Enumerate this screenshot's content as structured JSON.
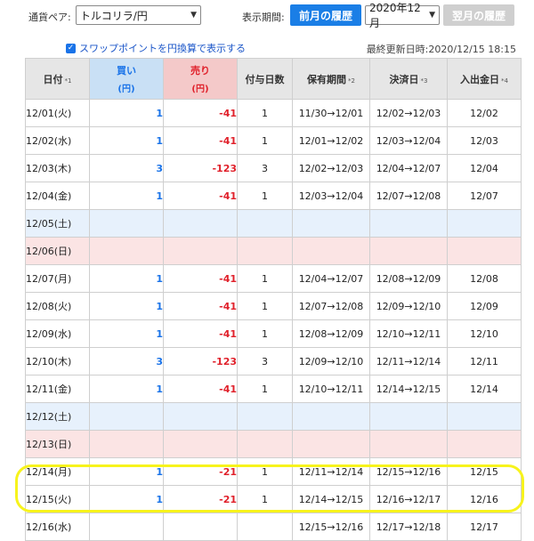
{
  "header": {
    "pair_label": "通貨ペア:",
    "pair_value": "トルコリラ/円",
    "period_label": "表示期間:",
    "prev_button": "前月の履歴",
    "month_value": "2020年12月",
    "next_button": "翌月の履歴"
  },
  "options": {
    "swap_yen_label": "スワップポイントを円換算で表示する",
    "swap_yen_checked": true
  },
  "updated": "最終更新日時:2020/12/15 18:15",
  "table": {
    "headers": {
      "date": "日付",
      "date_note": "*1",
      "buy": "買い",
      "buy_unit": "(円)",
      "sell": "売り",
      "sell_unit": "(円)",
      "days": "付与日数",
      "period": "保有期間",
      "period_note": "*2",
      "settle": "決済日",
      "settle_note": "*3",
      "cash": "入出金日",
      "cash_note": "*4"
    },
    "rows": [
      {
        "date": "12/01(火)",
        "buy": "1",
        "sell": "-41",
        "days": "1",
        "period": "11/30→12/01",
        "settle": "12/02→12/03",
        "cash": "12/02",
        "type": "weekday"
      },
      {
        "date": "12/02(水)",
        "buy": "1",
        "sell": "-41",
        "days": "1",
        "period": "12/01→12/02",
        "settle": "12/03→12/04",
        "cash": "12/03",
        "type": "weekday"
      },
      {
        "date": "12/03(木)",
        "buy": "3",
        "sell": "-123",
        "days": "3",
        "period": "12/02→12/03",
        "settle": "12/04→12/07",
        "cash": "12/04",
        "type": "weekday"
      },
      {
        "date": "12/04(金)",
        "buy": "1",
        "sell": "-41",
        "days": "1",
        "period": "12/03→12/04",
        "settle": "12/07→12/08",
        "cash": "12/07",
        "type": "weekday"
      },
      {
        "date": "12/05(土)",
        "buy": "",
        "sell": "",
        "days": "",
        "period": "",
        "settle": "",
        "cash": "",
        "type": "sat"
      },
      {
        "date": "12/06(日)",
        "buy": "",
        "sell": "",
        "days": "",
        "period": "",
        "settle": "",
        "cash": "",
        "type": "sun"
      },
      {
        "date": "12/07(月)",
        "buy": "1",
        "sell": "-41",
        "days": "1",
        "period": "12/04→12/07",
        "settle": "12/08→12/09",
        "cash": "12/08",
        "type": "weekday"
      },
      {
        "date": "12/08(火)",
        "buy": "1",
        "sell": "-41",
        "days": "1",
        "period": "12/07→12/08",
        "settle": "12/09→12/10",
        "cash": "12/09",
        "type": "weekday"
      },
      {
        "date": "12/09(水)",
        "buy": "1",
        "sell": "-41",
        "days": "1",
        "period": "12/08→12/09",
        "settle": "12/10→12/11",
        "cash": "12/10",
        "type": "weekday"
      },
      {
        "date": "12/10(木)",
        "buy": "3",
        "sell": "-123",
        "days": "3",
        "period": "12/09→12/10",
        "settle": "12/11→12/14",
        "cash": "12/11",
        "type": "weekday"
      },
      {
        "date": "12/11(金)",
        "buy": "1",
        "sell": "-41",
        "days": "1",
        "period": "12/10→12/11",
        "settle": "12/14→12/15",
        "cash": "12/14",
        "type": "weekday"
      },
      {
        "date": "12/12(土)",
        "buy": "",
        "sell": "",
        "days": "",
        "period": "",
        "settle": "",
        "cash": "",
        "type": "sat"
      },
      {
        "date": "12/13(日)",
        "buy": "",
        "sell": "",
        "days": "",
        "period": "",
        "settle": "",
        "cash": "",
        "type": "sun"
      },
      {
        "date": "12/14(月)",
        "buy": "1",
        "sell": "-21",
        "days": "1",
        "period": "12/11→12/14",
        "settle": "12/15→12/16",
        "cash": "12/15",
        "type": "weekday"
      },
      {
        "date": "12/15(火)",
        "buy": "1",
        "sell": "-21",
        "days": "1",
        "period": "12/14→12/15",
        "settle": "12/16→12/17",
        "cash": "12/16",
        "type": "weekday"
      },
      {
        "date": "12/16(水)",
        "buy": "",
        "sell": "",
        "days": "",
        "period": "12/15→12/16",
        "settle": "12/17→12/18",
        "cash": "12/17",
        "type": "weekday"
      }
    ]
  },
  "colors": {
    "accent": "#1a7ee6",
    "buy": "#1a73e8",
    "sell": "#e0212b",
    "highlight": "#f7f31c"
  }
}
